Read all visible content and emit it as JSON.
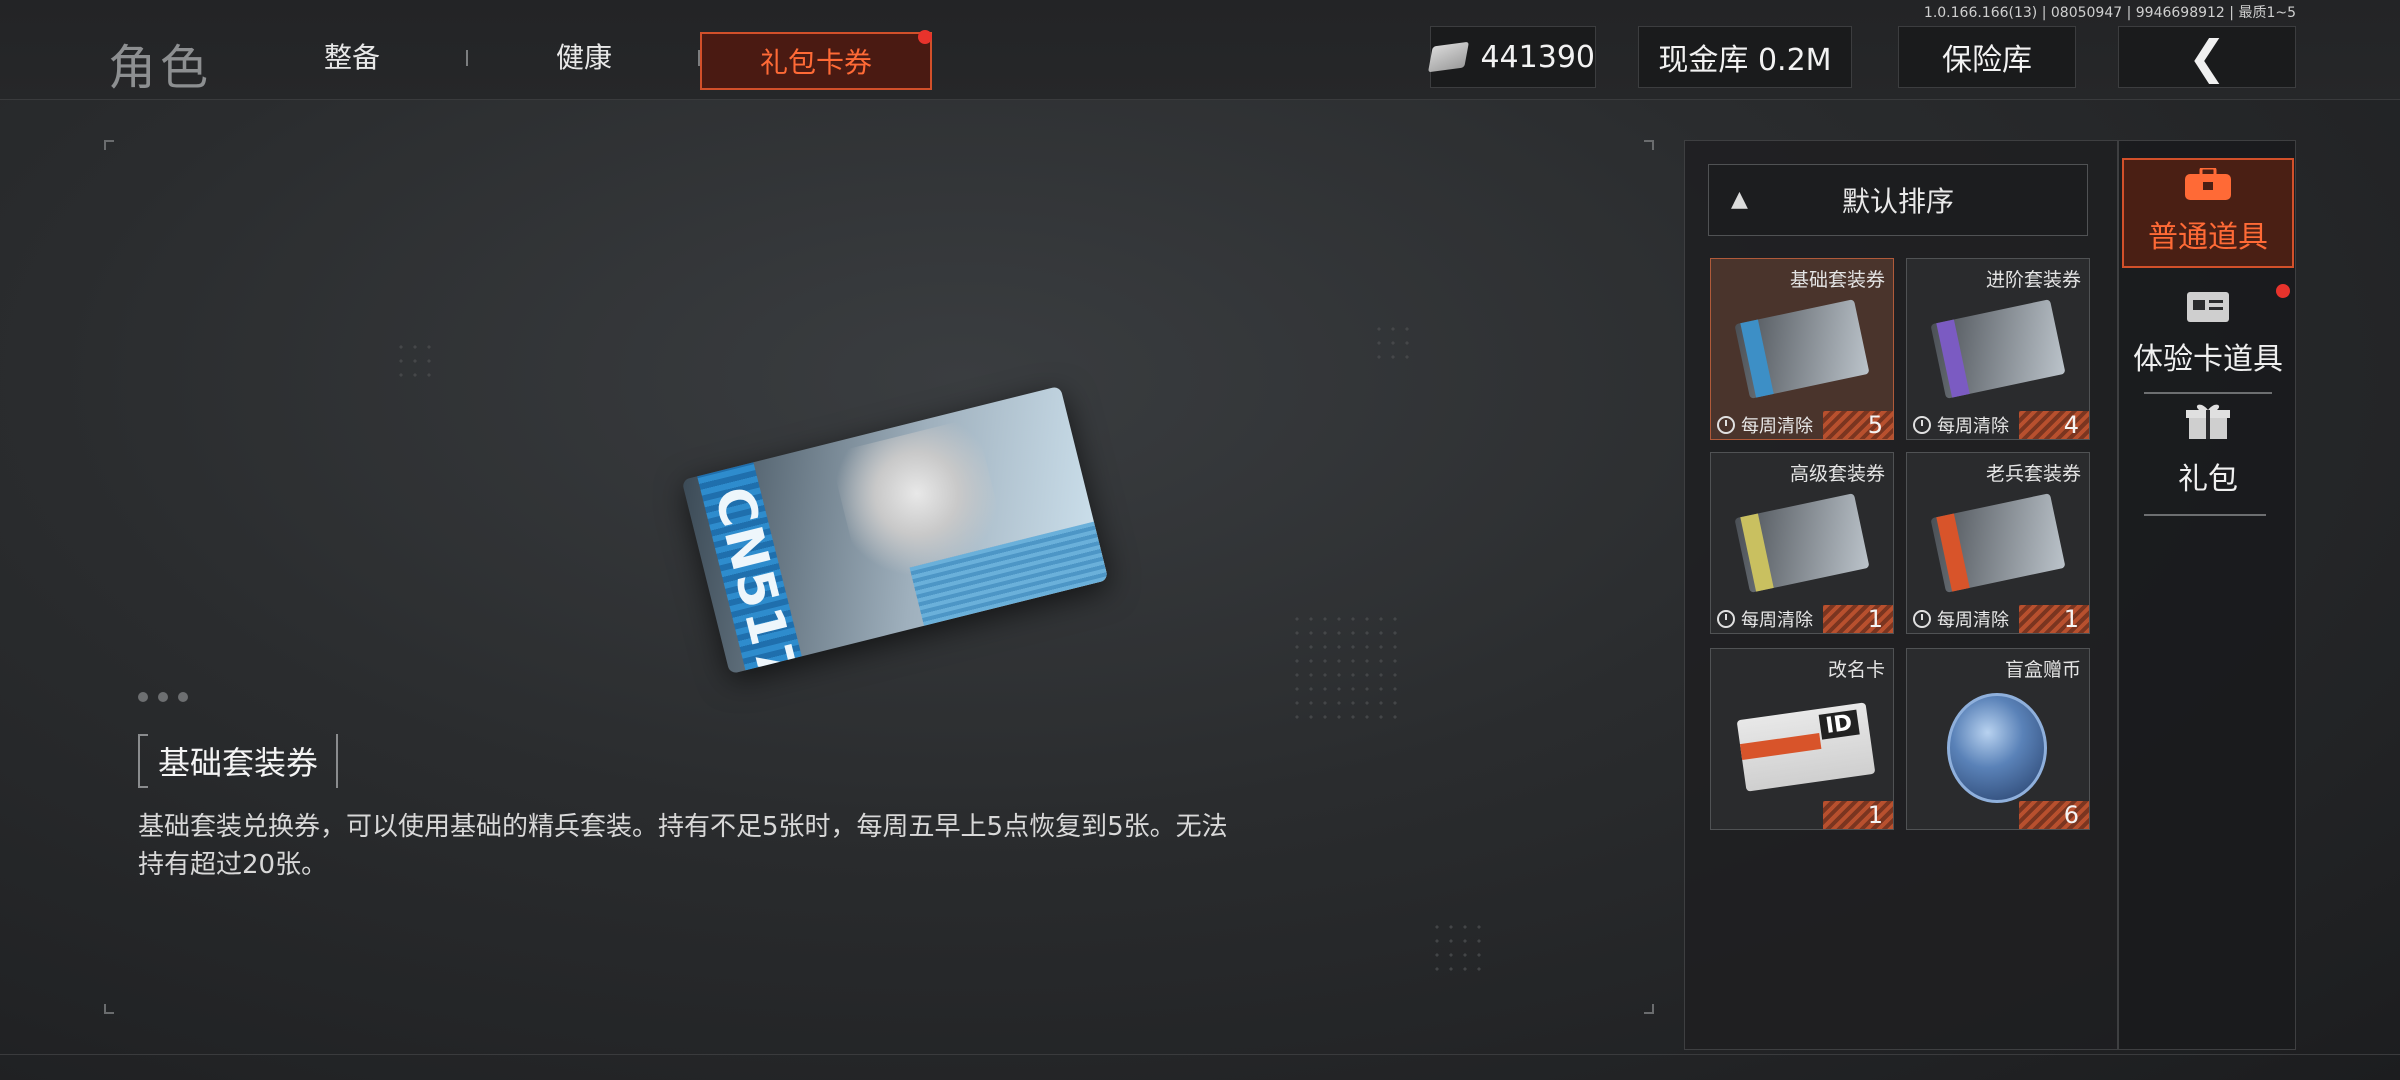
{
  "version": "1.0.166.166(13) | 08050947 | 9946698912 | 最质1~5",
  "header": {
    "title": "角色",
    "tabs": [
      "整备",
      "健康"
    ],
    "active_tab": "礼包卡券",
    "currency_value": "441390",
    "cash_vault": "现金库 0.2M",
    "safe_box": "保险库"
  },
  "detail": {
    "item_name": "基础套装券",
    "description": "基础套装兑换券，可以使用基础的精兵套装。持有不足5张时，每周五早上5点恢复到5张。无法持有超过20张。",
    "card_code": "CN517"
  },
  "inventory": {
    "sort_label": "默认排序",
    "items": [
      {
        "name": "基础套装券",
        "tag": "每周清除",
        "count": "5",
        "color": "#3d8fc6"
      },
      {
        "name": "进阶套装券",
        "tag": "每周清除",
        "count": "4",
        "color": "#7b5bc2"
      },
      {
        "name": "高级套装券",
        "tag": "每周清除",
        "count": "1",
        "color": "#c9c060"
      },
      {
        "name": "老兵套装券",
        "tag": "每周清除",
        "count": "1",
        "color": "#d8542a"
      },
      {
        "name": "改名卡",
        "tag": "",
        "count": "1"
      },
      {
        "name": "盲盒赠币",
        "tag": "",
        "count": "6"
      }
    ]
  },
  "categories": [
    {
      "label": "普通道具",
      "icon": "toolbox-icon"
    },
    {
      "label": "体验卡道具",
      "icon": "trial-card-icon"
    },
    {
      "label": "礼包",
      "icon": "gift-icon"
    }
  ],
  "colors": {
    "accent": "#d2502a",
    "accent_text": "#ff6a36",
    "notify": "#e8332c"
  }
}
